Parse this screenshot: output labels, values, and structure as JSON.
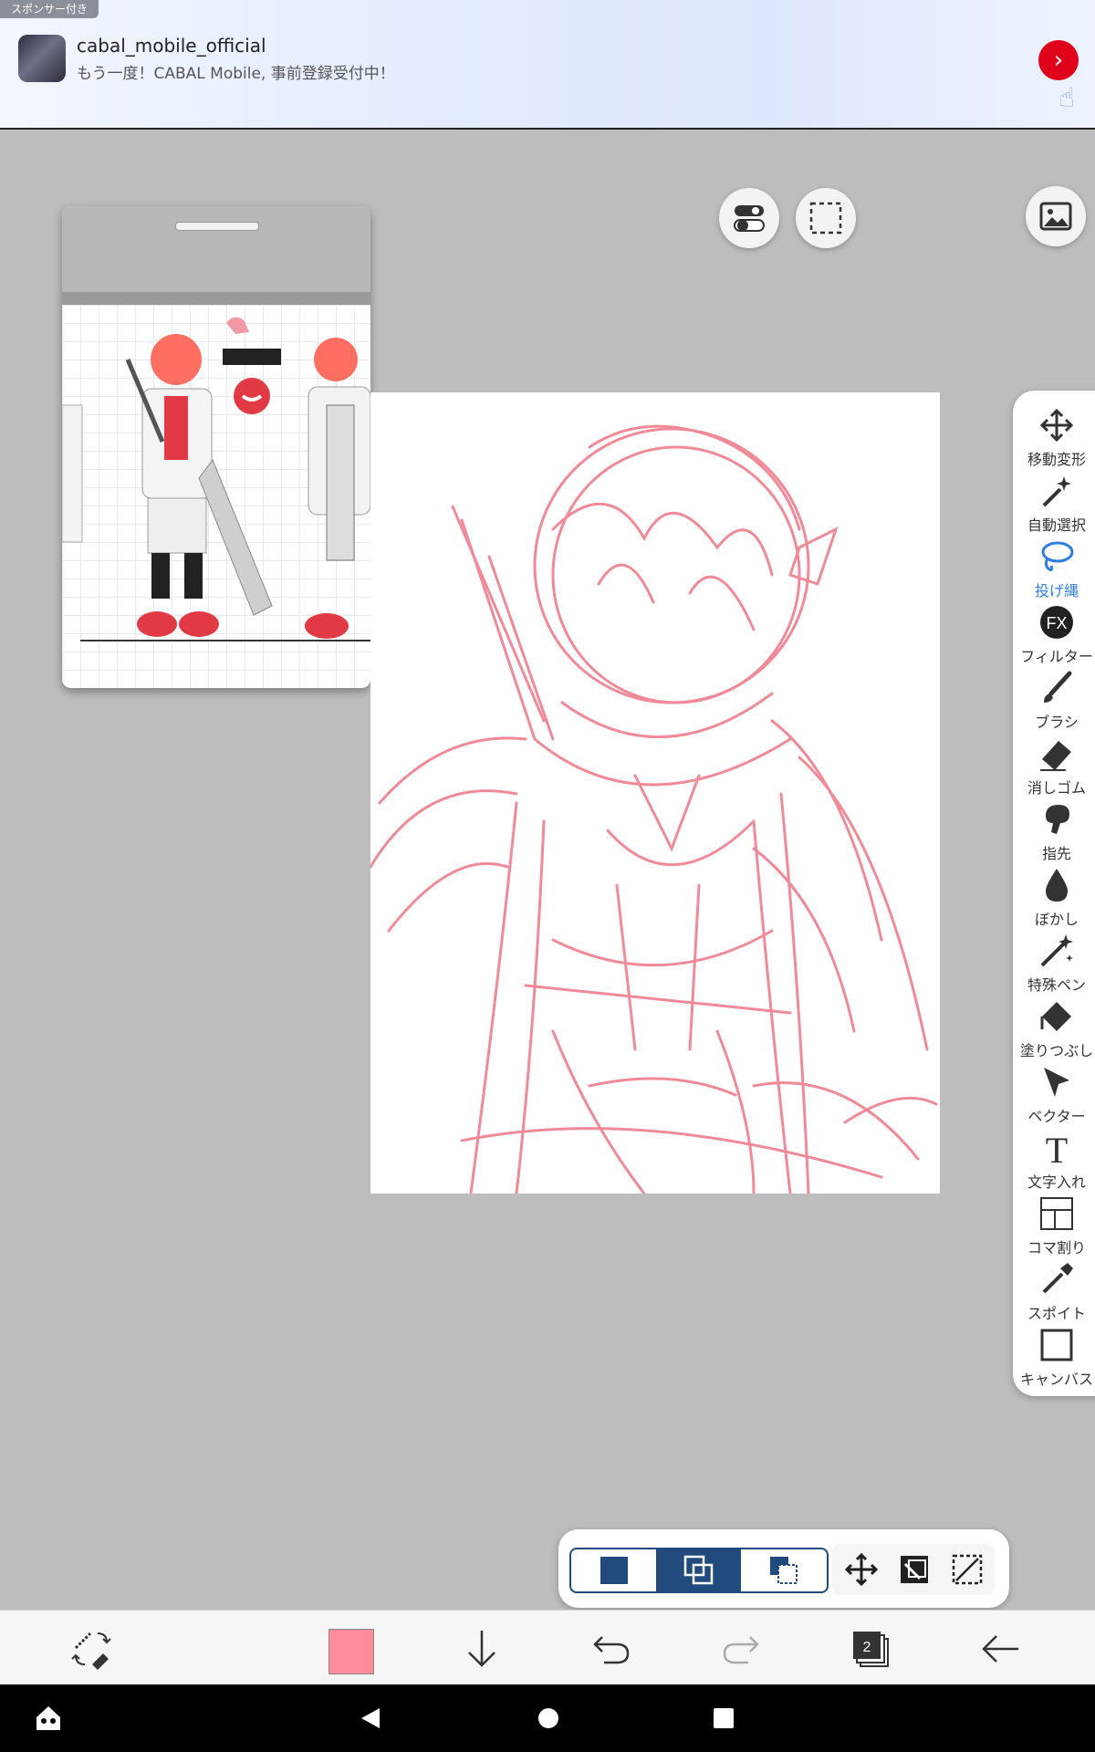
{
  "ad": {
    "sponsored_label": "スポンサー付き",
    "title": "cabal_mobile_official",
    "subtitle": "もう一度！CABAL Mobile, 事前登録受付中！"
  },
  "tools": [
    {
      "label": "移動変形",
      "icon": "move-transform-icon"
    },
    {
      "label": "自動選択",
      "icon": "magic-wand-icon"
    },
    {
      "label": "投げ縄",
      "icon": "lasso-icon",
      "active": true
    },
    {
      "label": "フィルター",
      "icon": "fx-filter-icon"
    },
    {
      "label": "ブラシ",
      "icon": "brush-icon"
    },
    {
      "label": "消しゴム",
      "icon": "eraser-icon"
    },
    {
      "label": "指先",
      "icon": "finger-smudge-icon"
    },
    {
      "label": "ぼかし",
      "icon": "blur-drop-icon"
    },
    {
      "label": "特殊ペン",
      "icon": "special-pen-icon"
    },
    {
      "label": "塗りつぶし",
      "icon": "fill-bucket-icon"
    },
    {
      "label": "ベクター",
      "icon": "vector-cursor-icon"
    },
    {
      "label": "文字入れ",
      "icon": "text-tool-icon"
    },
    {
      "label": "コマ割り",
      "icon": "panel-layout-icon"
    },
    {
      "label": "スポイト",
      "icon": "eyedropper-icon"
    },
    {
      "label": "キャンバス",
      "icon": "canvas-icon"
    }
  ],
  "filter_icon_text": "FX",
  "text_icon_text": "T",
  "layers_count": "2",
  "colors": {
    "current_color": "#ff8b9b",
    "sketch_stroke": "#f08a98",
    "accent_blue": "#214b7d",
    "active_tool_blue": "#2f7ddc"
  }
}
